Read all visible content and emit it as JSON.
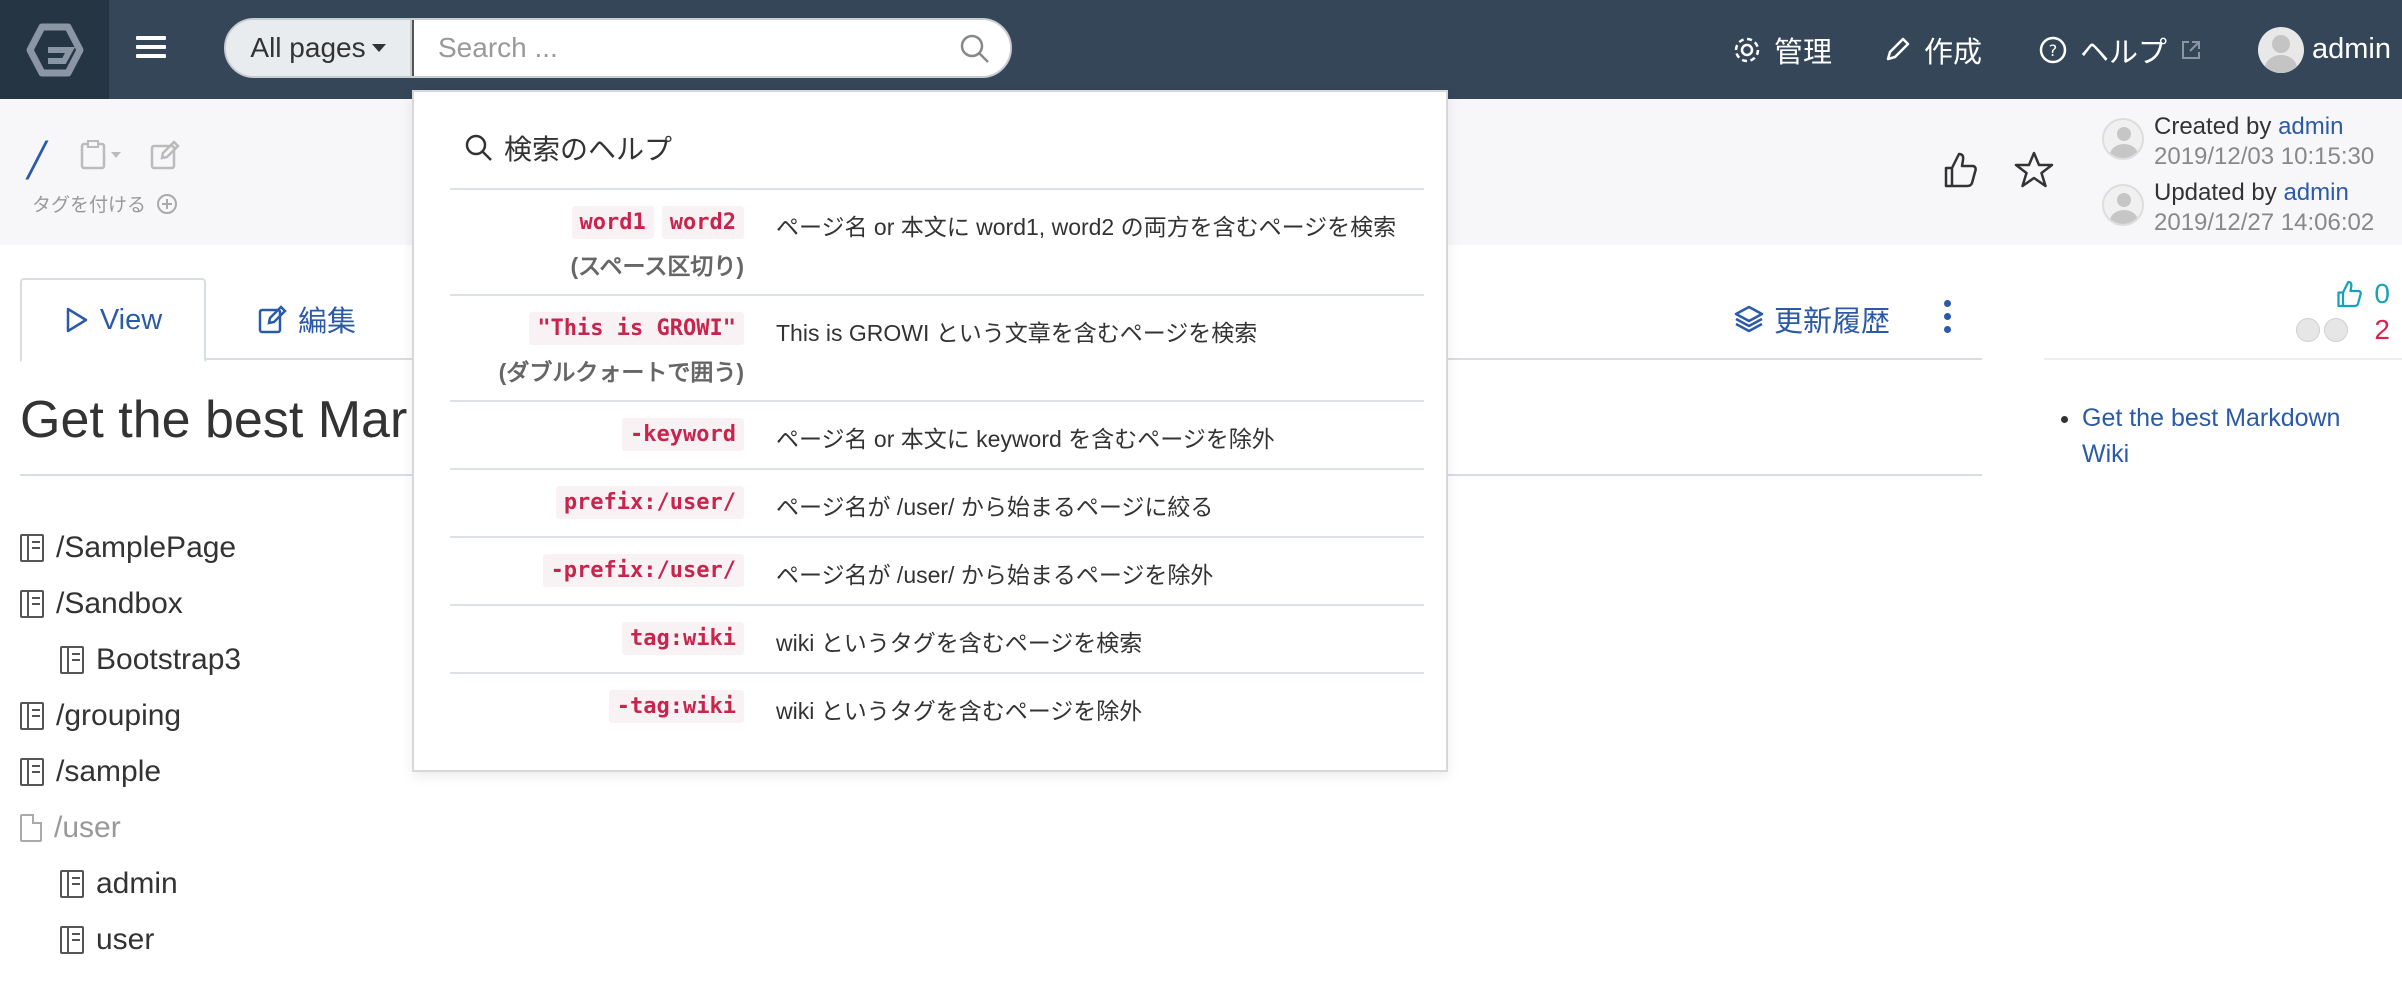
{
  "navbar": {
    "search_scope": "All pages",
    "search_placeholder": "Search ...",
    "admin_label": "管理",
    "create_label": "作成",
    "help_label": "ヘルプ",
    "user_label": "admin"
  },
  "page_header": {
    "path": "/",
    "tag_label": "タグを付ける",
    "created_label": "Created by",
    "created_user": "admin",
    "created_date": "2019/12/03 10:15:30",
    "updated_label": "Updated by",
    "updated_user": "admin",
    "updated_date": "2019/12/27 14:06:02"
  },
  "tabs": {
    "view": "View",
    "edit": "編集",
    "history": "更新履歴"
  },
  "side": {
    "like_count": "0",
    "seen_count": "2",
    "toc": [
      "Get the best Markdown Wiki"
    ]
  },
  "main": {
    "title": "Get the best Mar",
    "tree": [
      {
        "label": "/SamplePage"
      },
      {
        "label": "/Sandbox"
      },
      {
        "label": "Bootstrap3"
      },
      {
        "label": "/grouping"
      },
      {
        "label": "/sample"
      },
      {
        "label": "/user"
      },
      {
        "label": "admin"
      },
      {
        "label": "user"
      }
    ]
  },
  "search_help": {
    "title": "検索のヘルプ",
    "rows": [
      {
        "keywords": [
          "word1",
          "word2"
        ],
        "note": "(スペース区切り)",
        "desc": "ページ名 or 本文に word1, word2 の両方を含むページを検索"
      },
      {
        "keywords": [
          "\"This is GROWI\""
        ],
        "note": "(ダブルクォートで囲う)",
        "desc": "This is GROWI という文章を含むページを検索"
      },
      {
        "keywords": [
          "-keyword"
        ],
        "note": "",
        "desc": "ページ名 or 本文に keyword を含むページを除外"
      },
      {
        "keywords": [
          "prefix:/user/"
        ],
        "note": "",
        "desc": "ページ名が /user/ から始まるページに絞る"
      },
      {
        "keywords": [
          "-prefix:/user/"
        ],
        "note": "",
        "desc": "ページ名が /user/ から始まるページを除外"
      },
      {
        "keywords": [
          "tag:wiki"
        ],
        "note": "",
        "desc": "wiki というタグを含むページを検索"
      },
      {
        "keywords": [
          "-tag:wiki"
        ],
        "note": "",
        "desc": "wiki というタグを含むページを除外"
      }
    ]
  },
  "colors": {
    "navbar": "#344658",
    "logo_bg": "#263544",
    "link": "#2a5aa8",
    "keyword": "#c7254e",
    "like": "#17a2b8",
    "seen": "#e0204a"
  }
}
